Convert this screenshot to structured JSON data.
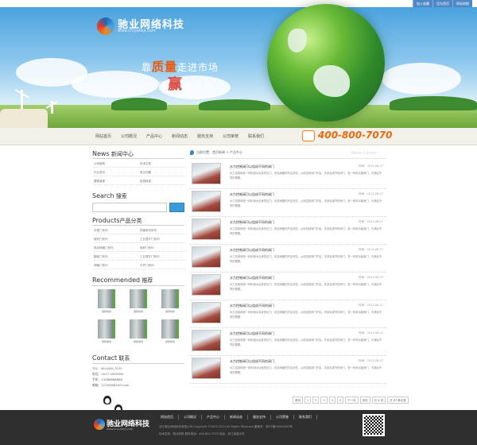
{
  "top_links": [
    "加入收藏",
    "设为首页",
    "网站地图"
  ],
  "brand": {
    "name": "驰业网络科技",
    "url_text": "www.chiyekeji.com"
  },
  "banner": {
    "slogan1_pre": "靠",
    "slogan1_hi": "质量",
    "slogan1_post": "走进市场",
    "slogan2_pre": "凭",
    "slogan2_hi": "赢",
    "slogan2_post": "得合作"
  },
  "nav": [
    "网站首页",
    "公司概况",
    "产品中心",
    "新闻动态",
    "服务支持",
    "公司荣誉",
    "联系我们"
  ],
  "phone": "400-800-7070",
  "sidebar": {
    "news_en": "News",
    "news_cn": "新闻中心",
    "news_items": [
      "公司新闻",
      "技术文档",
      "行业资讯",
      "常见问题",
      "要闻速递",
      "促销信息"
    ],
    "search_en": "Search",
    "search_cn": "搜索",
    "products_en": "Products",
    "products_cn": "产品分类",
    "product_items": [
      "平移门系列",
      "快速卷帘系列",
      "堆积门系列",
      "工业提升门系列",
      "电动伸缩门系列",
      "堆积门系列",
      "翻板门系列",
      "工业提升门系列",
      "伸缩门系列",
      "平开门系列"
    ],
    "recommended_en": "Recommended",
    "recommended_cn": "推荐",
    "recommended_items": [
      "钢质卷闸",
      "钢质卷闸",
      "钢质卷闸",
      "钢质卷闸",
      "钢质卷闸",
      "钢质卷闸"
    ],
    "contact_en": "Contact",
    "contact_cn": "联系",
    "contact_lines": [
      "TEL：400-800-7070",
      "电话：0577-5505990",
      "手机：13088888888",
      "邮箱：123456@163.com"
    ]
  },
  "breadcrumb": "当前位置：首页新闻 > 产品中心",
  "news_watermark": "News Center",
  "news": [
    {
      "title": "水力控制阀可以组成不同的阀门",
      "date": "时间：2013-06-27",
      "desc": "水力控制阀是一种利用水自身的压力，改变阀瓣的开启状态，从而控制阀门开启、关闭及调节的阀门。是一种多功能阀门，可满足不同的需要。"
    },
    {
      "title": "水力控制阀可以组成不同的阀门",
      "date": "时间：2013-06-27",
      "desc": "水力控制阀是一种利用水自身的压力，改变阀瓣的开启状态，从而控制阀门开启、关闭及调节的阀门。是一种多功能阀门，可满足不同的需要。"
    },
    {
      "title": "水力控制阀可以组成不同的阀门",
      "date": "时间：2013-06-27",
      "desc": "水力控制阀是一种利用水自身的压力，改变阀瓣的开启状态，从而控制阀门开启、关闭及调节的阀门。是一种多功能阀门，可满足不同的需要。"
    },
    {
      "title": "水力控制阀可以组成不同的阀门",
      "date": "时间：2013-06-27",
      "desc": "水力控制阀是一种利用水自身的压力，改变阀瓣的开启状态，从而控制阀门开启、关闭及调节的阀门。是一种多功能阀门，可满足不同的需要。"
    },
    {
      "title": "水力控制阀可以组成不同的阀门",
      "date": "时间：2013-06-27",
      "desc": "水力控制阀是一种利用水自身的压力，改变阀瓣的开启状态，从而控制阀门开启、关闭及调节的阀门。是一种多功能阀门，可满足不同的需要。"
    },
    {
      "title": "水力控制阀可以组成不同的阀门",
      "date": "时间：2013-06-27",
      "desc": "水力控制阀是一种利用水自身的压力，改变阀瓣的开启状态，从而控制阀门开启、关闭及调节的阀门。是一种多功能阀门，可满足不同的需要。"
    },
    {
      "title": "水力控制阀可以组成不同的阀门",
      "date": "时间：2013-06-27",
      "desc": "水力控制阀是一种利用水自身的压力，改变阀瓣的开启状态，从而控制阀门开启、关闭及调节的阀门。是一种多功能阀门，可满足不同的需要。"
    },
    {
      "title": "水力控制阀可以组成不同的阀门",
      "date": "时间：2013-06-27",
      "desc": "水力控制阀是一种利用水自身的压力，改变阀瓣的开启状态，从而控制阀门开启、关闭及调节的阀门。是一种多功能阀门，可满足不同的需要。"
    }
  ],
  "pager": [
    "首页",
    "1",
    "2",
    "3",
    "4",
    "5",
    "下一页",
    "末页",
    "共 8 页",
    "共 67 条记录"
  ],
  "footer": {
    "nav": [
      "网站首页",
      "公司概况",
      "产品中心",
      "新闻动态",
      "服务支持",
      "公司荣誉",
      "联系我们"
    ],
    "line1": "浙江驰业网络科技有限公司 Copyright ©2003-2013 All Rights Reserved 备案号：浙ICP备00000000号",
    "line2": "技术支持：驰业网络   服务电话：400-800-7070   地址：浙江省温州市"
  },
  "colors": {
    "accent_orange": "#e56a0e",
    "link_blue": "#3b9ad8",
    "footer_bg": "#2f2f2f"
  }
}
